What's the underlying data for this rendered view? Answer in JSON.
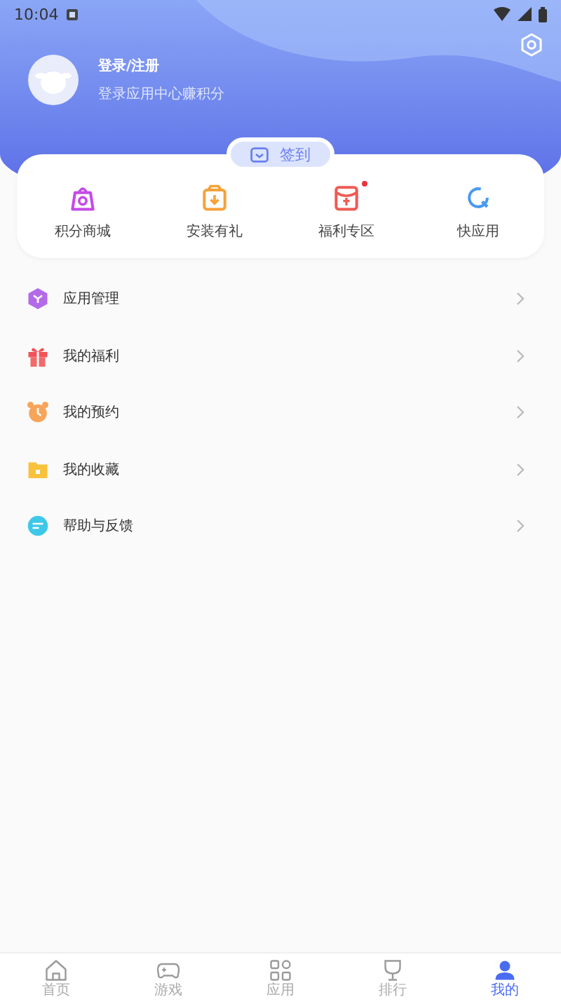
{
  "status_bar": {
    "time": "10:04"
  },
  "profile": {
    "name": "登录/注册",
    "subtitle": "登录应用中心赚积分"
  },
  "sign_in_button": {
    "label": "签到"
  },
  "shortcuts": [
    {
      "label": "积分商城",
      "badge": false
    },
    {
      "label": "安装有礼",
      "badge": false
    },
    {
      "label": "福利专区",
      "badge": true
    },
    {
      "label": "快应用",
      "badge": false
    }
  ],
  "menu": [
    {
      "label": "应用管理"
    },
    {
      "label": "我的福利"
    },
    {
      "label": "我的预约"
    },
    {
      "label": "我的收藏"
    },
    {
      "label": "帮助与反馈"
    }
  ],
  "tab_bar": [
    {
      "label": "首页",
      "selected": false
    },
    {
      "label": "游戏",
      "selected": false
    },
    {
      "label": "应用",
      "selected": false
    },
    {
      "label": "排行",
      "selected": false
    },
    {
      "label": "我的",
      "selected": true
    }
  ]
}
